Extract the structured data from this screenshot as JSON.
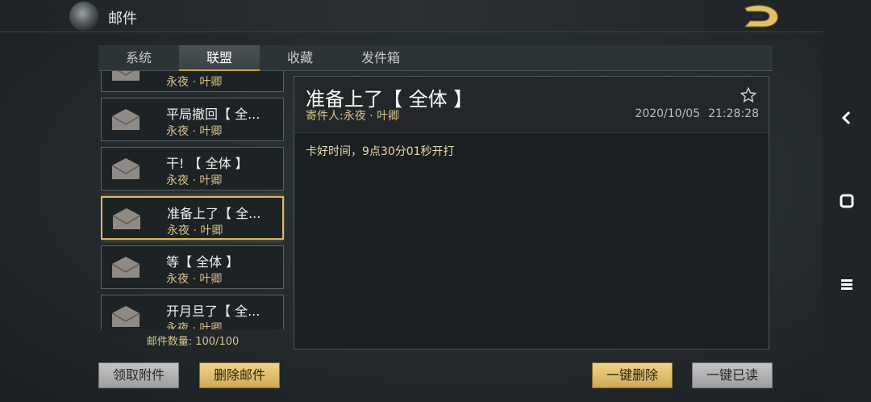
{
  "header": {
    "title": "邮件"
  },
  "tabs": [
    {
      "label": "系统"
    },
    {
      "label": "联盟"
    },
    {
      "label": "收藏"
    },
    {
      "label": "发件箱"
    }
  ],
  "active_tab": "联盟",
  "mail_list": {
    "items": [
      {
        "subject": "",
        "sender": "永夜 · 叶卿"
      },
      {
        "subject": "平局撤回【 全...",
        "sender": "永夜 · 叶卿"
      },
      {
        "subject": "干! 【 全体 】",
        "sender": "永夜 · 叶卿"
      },
      {
        "subject": "准备上了【 全...",
        "sender": "永夜 · 叶卿",
        "selected": true
      },
      {
        "subject": "等【 全体 】",
        "sender": "永夜 · 叶卿"
      },
      {
        "subject": "开月旦了【 全...",
        "sender": "永夜 · 叶卿"
      }
    ],
    "count_label": "邮件数量: 100/100"
  },
  "detail": {
    "title": "准备上了【 全体 】",
    "sender_label": "寄件人:",
    "sender": "永夜 · 叶卿",
    "date": "2020/10/05",
    "time": "21:28:28",
    "body": "卡好时间，9点30分01秒开打"
  },
  "buttons": {
    "claim_attachments": "领取附件",
    "delete_mail": "删除邮件",
    "delete_all": "一键删除",
    "read_all": "一键已读"
  },
  "colors": {
    "accent_gold": "#d8b863",
    "sender_text": "#d6c489"
  }
}
